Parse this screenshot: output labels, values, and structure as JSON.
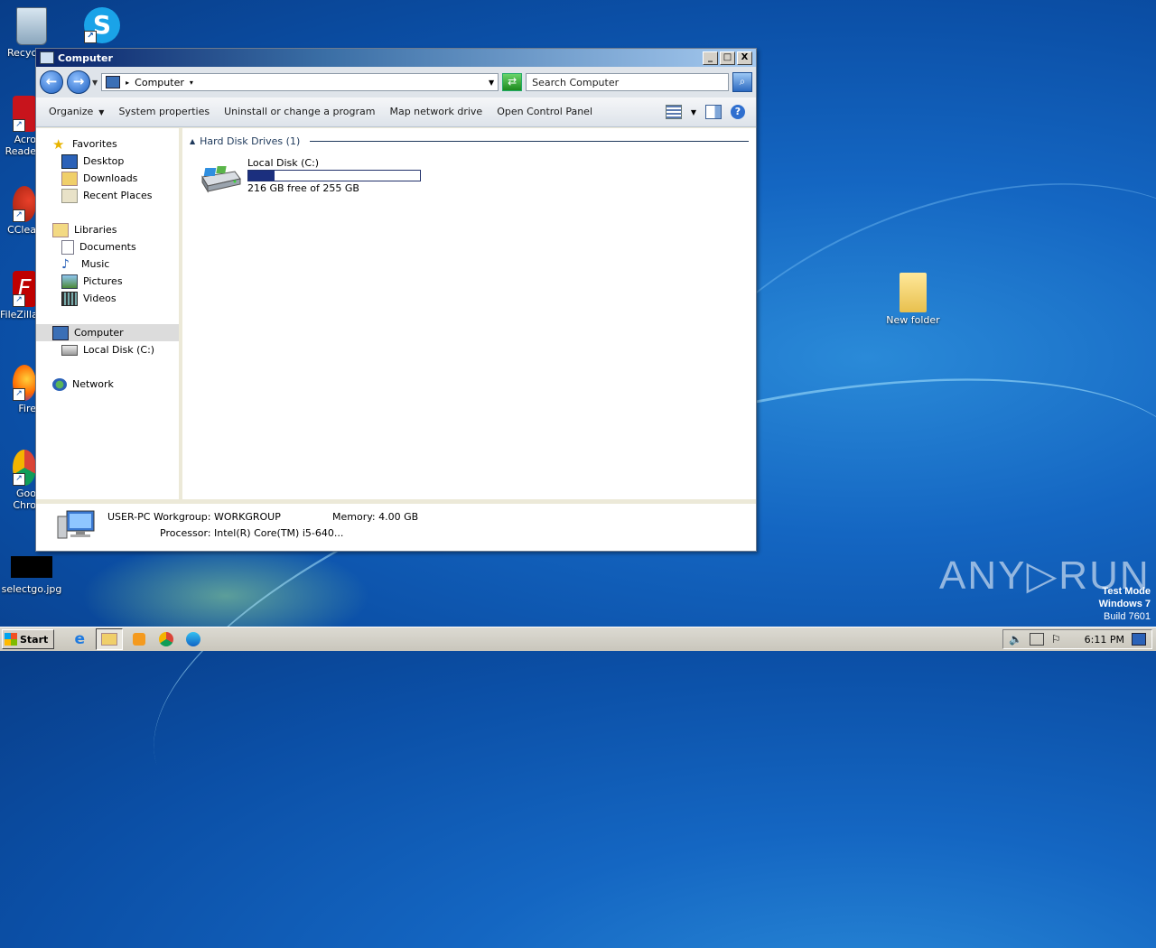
{
  "window": {
    "title": "Computer",
    "minimize": "_",
    "maximize": "□",
    "close": "X"
  },
  "addressbar": {
    "location": "Computer",
    "search_placeholder": "Search Computer"
  },
  "toolbar": {
    "organize": "Organize",
    "system_properties": "System properties",
    "uninstall": "Uninstall or change a program",
    "map_drive": "Map network drive",
    "control_panel": "Open Control Panel",
    "help": "?"
  },
  "navpane": {
    "favorites": "Favorites",
    "desktop": "Desktop",
    "downloads": "Downloads",
    "recent": "Recent Places",
    "libraries": "Libraries",
    "documents": "Documents",
    "music": "Music",
    "pictures": "Pictures",
    "videos": "Videos",
    "computer": "Computer",
    "local_disk": "Local Disk (C:)",
    "network": "Network"
  },
  "content": {
    "group_header": "Hard Disk Drives (1)",
    "drive_name": "Local Disk (C:)",
    "drive_free": "216 GB free of 255 GB",
    "drive_used_fraction": 0.153
  },
  "details": {
    "line1": "USER-PC  Workgroup: WORKGROUP",
    "processor": "Processor: Intel(R) Core(TM) i5-640...",
    "memory": "Memory: 4.00 GB"
  },
  "desktop_icons": {
    "recycle": "Recyc",
    "acrobat_1": "Acro",
    "acrobat_2": "Reade",
    "ccleaner": "CClea",
    "filezilla": "FileZilla",
    "firefox": "Fire",
    "chrome_1": "Goo",
    "chrome_2": "Chro",
    "selectgo": "selectgo.jpg",
    "new_folder": "New folder"
  },
  "watermark": {
    "anyrun": "ANY▷RUN",
    "test_mode": "Test Mode",
    "os": "Windows 7",
    "build": "Build 7601"
  },
  "taskbar": {
    "start": "Start",
    "clock": "6:11 PM"
  },
  "colors": {
    "desktop": "#1466c2",
    "titlebar_start": "#0a246a",
    "usage_fill": "#1b2f7e"
  }
}
